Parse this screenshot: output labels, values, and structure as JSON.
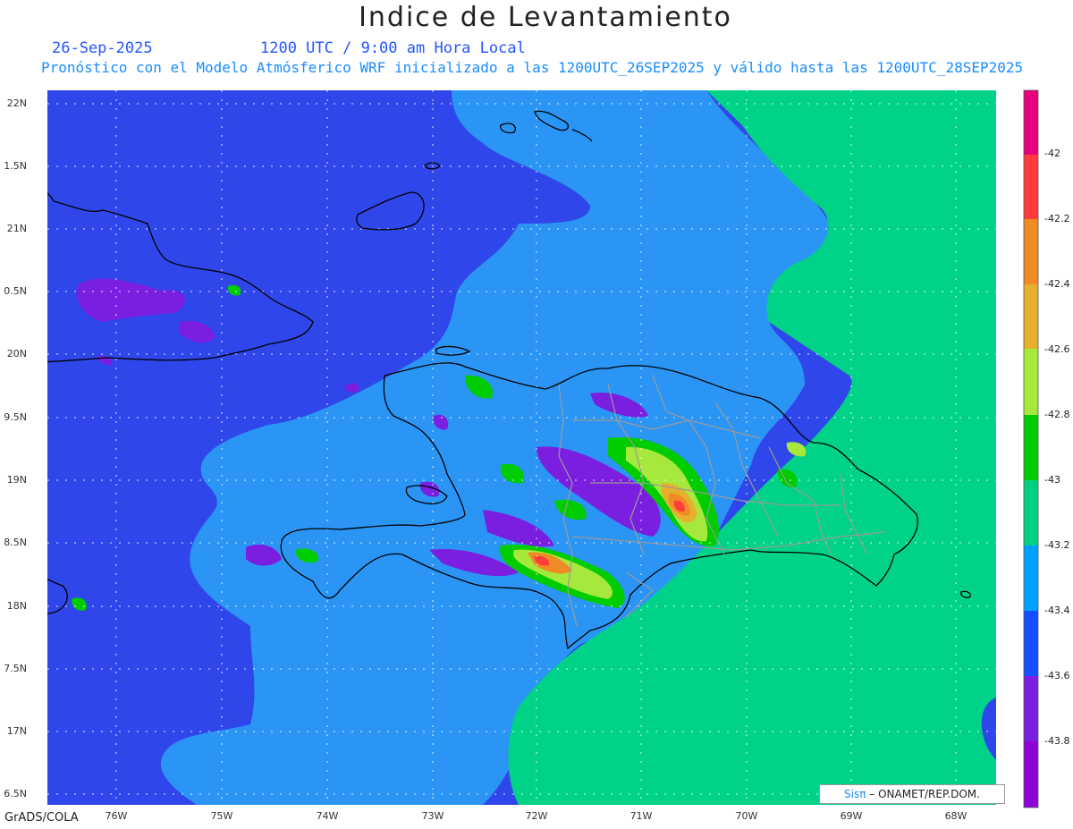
{
  "header": {
    "title": "Indice de Levantamiento",
    "date": "26-Sep-2025",
    "time_label": "1200 UTC / 9:00 am Hora Local",
    "subtitle": "Pronóstico con el Modelo Atmósferico WRF inicializado a las 1200UTC_26SEP2025 y válido hasta las  1200UTC_28SEP2025"
  },
  "axes": {
    "y_ticks": [
      "22N",
      "1.5N",
      "21N",
      "0.5N",
      "20N",
      "9.5N",
      "19N",
      "8.5N",
      "18N",
      "7.5N",
      "17N",
      "6.5N"
    ],
    "x_ticks": [
      "76W",
      "75W",
      "74W",
      "73W",
      "72W",
      "71W",
      "70W",
      "69W",
      "68W"
    ],
    "lat_range": [
      16.5,
      22.0
    ],
    "lon_range": [
      -76.65,
      -67.6
    ],
    "grid": true
  },
  "colorbar": {
    "labels": [
      "-42",
      "-42.2",
      "-42.4",
      "-42.6",
      "-42.8",
      "-43",
      "-43.2",
      "-43.4",
      "-43.6",
      "-43.8"
    ],
    "colors": [
      "#e6007e",
      "#ff3b3b",
      "#f08a24",
      "#e6b02e",
      "#a6e83c",
      "#00cc00",
      "#00d080",
      "#00a0ff",
      "#1450ff",
      "#7a1fe0",
      "#8f00d6"
    ]
  },
  "credit": {
    "sis": "Sis",
    "pi": "π",
    "org": "– ONAMET/REP.DOM."
  },
  "footer": {
    "software": "GrADS/COLA"
  },
  "palette": {
    "deep_blue": "#2f47ea",
    "light_blue": "#2a95f5",
    "sea_green": "#00d387",
    "purple": "#7a1fe0",
    "green": "#00cc00",
    "lime": "#a6e83c",
    "orange": "#f08a24",
    "red": "#ff3b3b"
  }
}
